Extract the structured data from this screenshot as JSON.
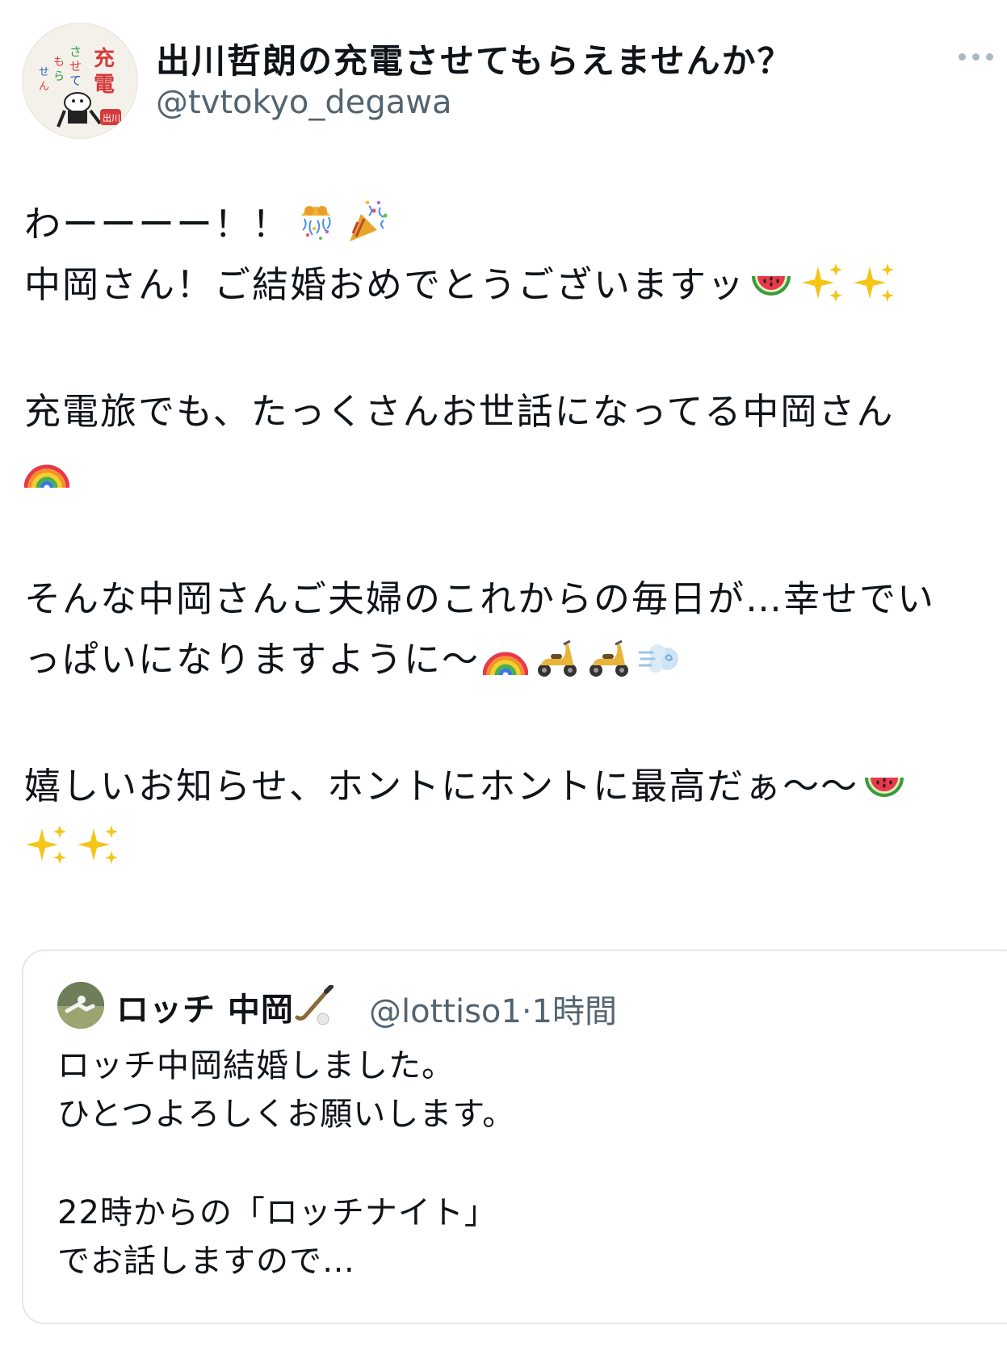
{
  "header": {
    "display_name": "出川哲朗の充電させてもらえませんか？",
    "handle": "@tvtokyo_degawa",
    "avatar_icon": "program-logo-avatar",
    "more_icon": "more-options-icon"
  },
  "tweet": {
    "line1": "わーーーー！！",
    "line1_emojis": [
      "confetti-ball-icon",
      "party-popper-icon"
    ],
    "line2": "中岡さん！ご結婚おめでとうございますッ",
    "line2_emojis": [
      "watermelon-icon",
      "sparkles-icon",
      "sparkles-icon"
    ],
    "line3": "充電旅でも、たっくさんお世話になってる中岡さん",
    "line4_emojis": [
      "rainbow-icon"
    ],
    "line5": "そんな中岡さんご夫婦のこれからの毎日が…幸せでい",
    "line6": "っぱいになりますように〜",
    "line6_emojis": [
      "rainbow-icon",
      "motor-scooter-icon",
      "motor-scooter-icon",
      "dashing-away-icon"
    ],
    "line7": "嬉しいお知らせ、ホントにホントに最高だぁ〜〜",
    "line7_emojis": [
      "watermelon-icon"
    ],
    "line8_emojis": [
      "sparkles-icon",
      "sparkles-icon"
    ]
  },
  "quote": {
    "name": "ロッチ 中岡",
    "name_emoji": "field-hockey-icon",
    "handle": "@lottiso1",
    "separator": "·",
    "time": "1時間",
    "text_line1": "ロッチ中岡結婚しました。",
    "text_line2": "ひとつよろしくお願いします。",
    "text_line3": "22時からの「ロッチナイト」",
    "text_line4": "でお話しますので…"
  },
  "colors": {
    "text": "#0f1419",
    "secondary": "#536471",
    "border": "#e1e8ed"
  }
}
